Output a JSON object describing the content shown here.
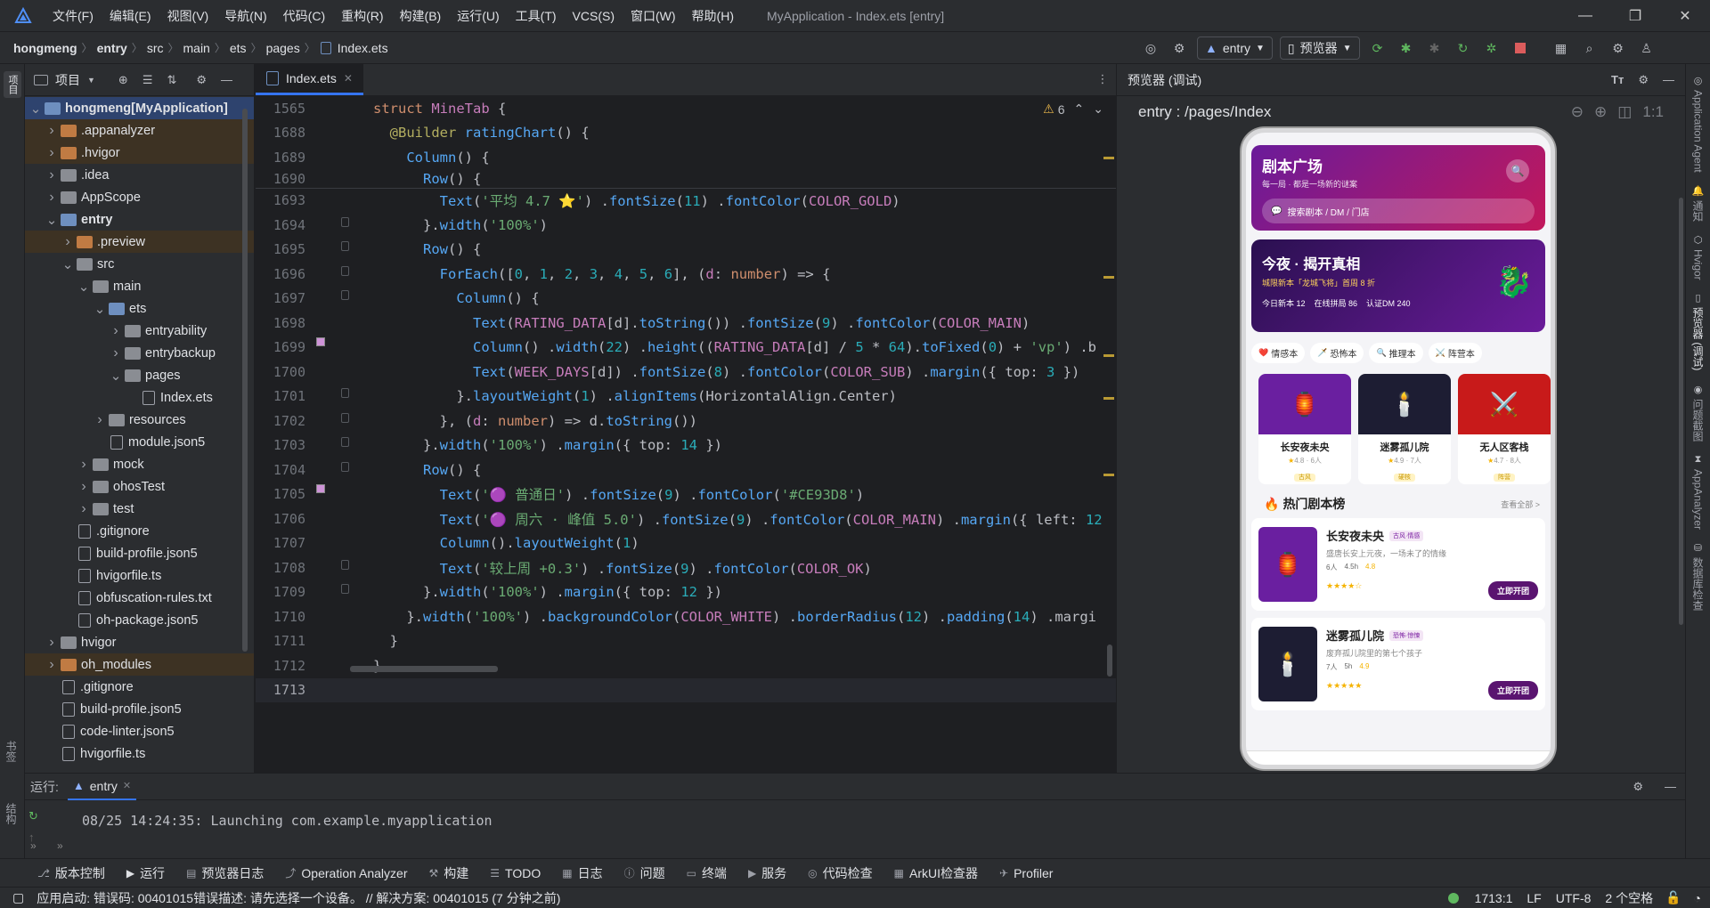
{
  "window": {
    "menus": [
      "文件(F)",
      "编辑(E)",
      "视图(V)",
      "导航(N)",
      "代码(C)",
      "重构(R)",
      "构建(B)",
      "运行(U)",
      "工具(T)",
      "VCS(S)",
      "窗口(W)",
      "帮助(H)"
    ],
    "title": "MyApplication - Index.ets [entry]"
  },
  "nav": {
    "breadcrumbs": [
      "hongmeng",
      "entry",
      "src",
      "main",
      "ets",
      "pages",
      "Index.ets"
    ],
    "run_config": "entry",
    "device": "预览器"
  },
  "project": {
    "title": "项目",
    "tree": [
      {
        "label": "hongmeng",
        "suffix": " [MyApplication]",
        "depth": 0,
        "arrow": "open",
        "kind": "folder-blue",
        "sel": true
      },
      {
        "label": ".appanalyzer",
        "depth": 1,
        "arrow": "closed",
        "kind": "folder-orange",
        "hl": true
      },
      {
        "label": ".hvigor",
        "depth": 1,
        "arrow": "closed",
        "kind": "folder-orange",
        "hl": true
      },
      {
        "label": ".idea",
        "depth": 1,
        "arrow": "closed",
        "kind": "folder-gray"
      },
      {
        "label": "AppScope",
        "depth": 1,
        "arrow": "closed",
        "kind": "folder-gray"
      },
      {
        "label": "entry",
        "depth": 1,
        "arrow": "open",
        "kind": "folder-blue",
        "bold": true
      },
      {
        "label": ".preview",
        "depth": 2,
        "arrow": "closed",
        "kind": "folder-orange",
        "hl": true
      },
      {
        "label": "src",
        "depth": 2,
        "arrow": "open",
        "kind": "folder-gray"
      },
      {
        "label": "main",
        "depth": 3,
        "arrow": "open",
        "kind": "folder-gray"
      },
      {
        "label": "ets",
        "depth": 4,
        "arrow": "open",
        "kind": "folder-blue"
      },
      {
        "label": "entryability",
        "depth": 5,
        "arrow": "closed",
        "kind": "folder-gray"
      },
      {
        "label": "entrybackup",
        "depth": 5,
        "arrow": "closed",
        "kind": "folder-gray"
      },
      {
        "label": "pages",
        "depth": 5,
        "arrow": "open",
        "kind": "folder-gray"
      },
      {
        "label": "Index.ets",
        "depth": 6,
        "arrow": "none",
        "kind": "file"
      },
      {
        "label": "resources",
        "depth": 4,
        "arrow": "closed",
        "kind": "folder-gray"
      },
      {
        "label": "module.json5",
        "depth": 4,
        "arrow": "none",
        "kind": "file"
      },
      {
        "label": "mock",
        "depth": 3,
        "arrow": "closed",
        "kind": "folder-gray"
      },
      {
        "label": "ohosTest",
        "depth": 3,
        "arrow": "closed",
        "kind": "folder-gray"
      },
      {
        "label": "test",
        "depth": 3,
        "arrow": "closed",
        "kind": "folder-gray"
      },
      {
        "label": ".gitignore",
        "depth": 2,
        "arrow": "none",
        "kind": "file"
      },
      {
        "label": "build-profile.json5",
        "depth": 2,
        "arrow": "none",
        "kind": "file"
      },
      {
        "label": "hvigorfile.ts",
        "depth": 2,
        "arrow": "none",
        "kind": "file"
      },
      {
        "label": "obfuscation-rules.txt",
        "depth": 2,
        "arrow": "none",
        "kind": "file"
      },
      {
        "label": "oh-package.json5",
        "depth": 2,
        "arrow": "none",
        "kind": "file"
      },
      {
        "label": "hvigor",
        "depth": 1,
        "arrow": "closed",
        "kind": "folder-gray"
      },
      {
        "label": "oh_modules",
        "depth": 1,
        "arrow": "closed",
        "kind": "folder-orange",
        "hl": true
      },
      {
        "label": ".gitignore",
        "depth": 1,
        "arrow": "none",
        "kind": "file"
      },
      {
        "label": "build-profile.json5",
        "depth": 1,
        "arrow": "none",
        "kind": "file"
      },
      {
        "label": "code-linter.json5",
        "depth": 1,
        "arrow": "none",
        "kind": "file"
      },
      {
        "label": "hvigorfile.ts",
        "depth": 1,
        "arrow": "none",
        "kind": "file"
      }
    ]
  },
  "editor": {
    "tab": "Index.ets",
    "warnings": "6",
    "sticky": [
      {
        "ln": "1565",
        "html": "<span class='kw'>struct</span> <span class='ty'>MineTab</span> {"
      },
      {
        "ln": "1688",
        "html": "  <span class='dec'>@Builder</span> <span class='fn'>ratingChart</span>() {"
      },
      {
        "ln": "1689",
        "html": "    <span class='fn'>Column</span>() {"
      },
      {
        "ln": "1690",
        "html": "      <span class='fn'>Row</span>() {"
      }
    ],
    "lines": [
      {
        "ln": "1693",
        "html": "        <span class='fn'>Text</span>(<span class='str'>'平均 4.7 ⭐'</span>) .<span class='fn'>fontSize</span>(<span class='num'>11</span>) .<span class='fn'>fontColor</span>(<span class='cn'>COLOR_GOLD</span>)"
      },
      {
        "ln": "1694",
        "html": "      }.<span class='fn'>width</span>(<span class='str'>'100%'</span>)"
      },
      {
        "ln": "1695",
        "html": "      <span class='fn'>Row</span>() {"
      },
      {
        "ln": "1696",
        "html": "        <span class='fn'>ForEach</span>([<span class='num'>0</span>, <span class='num'>1</span>, <span class='num'>2</span>, <span class='num'>3</span>, <span class='num'>4</span>, <span class='num'>5</span>, <span class='num'>6</span>], (<span class='param'>d</span>: <span class='kw'>number</span>) => {"
      },
      {
        "ln": "1697",
        "html": "          <span class='fn'>Column</span>() {"
      },
      {
        "ln": "1698",
        "html": "            <span class='fn'>Text</span>(<span class='cn'>RATING_DATA</span>[d].<span class='fn'>toString</span>()) .<span class='fn'>fontSize</span>(<span class='num'>9</span>) .<span class='fn'>fontColor</span>(<span class='cn'>COLOR_MAIN</span>)"
      },
      {
        "ln": "1699",
        "html": "            <span class='fn'>Column</span>() .<span class='fn'>width</span>(<span class='num'>22</span>) .<span class='fn'>height</span>((<span class='cn'>RATING_DATA</span>[d] / <span class='num'>5</span> * <span class='num'>64</span>).<span class='fn'>toFixed</span>(<span class='num'>0</span>) + <span class='str'>'vp'</span>) .b"
      },
      {
        "ln": "1700",
        "html": "            <span class='fn'>Text</span>(<span class='cn'>WEEK_DAYS</span>[d]) .<span class='fn'>fontSize</span>(<span class='num'>8</span>) .<span class='fn'>fontColor</span>(<span class='cn'>COLOR_SUB</span>) .<span class='fn'>margin</span>({ top: <span class='num'>3</span> })"
      },
      {
        "ln": "1701",
        "html": "          }.<span class='fn'>layoutWeight</span>(<span class='num'>1</span>) .<span class='fn'>alignItems</span>(HorizontalAlign.Center)"
      },
      {
        "ln": "1702",
        "html": "        }, (<span class='param'>d</span>: <span class='kw'>number</span>) => d.<span class='fn'>toString</span>())"
      },
      {
        "ln": "1703",
        "html": "      }.<span class='fn'>width</span>(<span class='str'>'100%'</span>) .<span class='fn'>margin</span>({ top: <span class='num'>14</span> })"
      },
      {
        "ln": "1704",
        "html": "      <span class='fn'>Row</span>() {"
      },
      {
        "ln": "1705",
        "html": "        <span class='fn'>Text</span>(<span class='str'>'🟣 普通日'</span>) .<span class='fn'>fontSize</span>(<span class='num'>9</span>) .<span class='fn'>fontColor</span>(<span class='str'>'#CE93D8'</span>)"
      },
      {
        "ln": "1706",
        "html": "        <span class='fn'>Text</span>(<span class='str'>'🟣 周六 · 峰值 5.0'</span>) .<span class='fn'>fontSize</span>(<span class='num'>9</span>) .<span class='fn'>fontColor</span>(<span class='cn'>COLOR_MAIN</span>) .<span class='fn'>margin</span>({ left: <span class='num'>12</span>"
      },
      {
        "ln": "1707",
        "html": "        <span class='fn'>Column</span>().<span class='fn'>layoutWeight</span>(<span class='num'>1</span>)"
      },
      {
        "ln": "1708",
        "html": "        <span class='fn'>Text</span>(<span class='str'>'较上周 +0.3'</span>) .<span class='fn'>fontSize</span>(<span class='num'>9</span>) .<span class='fn'>fontColor</span>(<span class='cn'>COLOR_OK</span>)"
      },
      {
        "ln": "1709",
        "html": "      }.<span class='fn'>width</span>(<span class='str'>'100%'</span>) .<span class='fn'>margin</span>({ top: <span class='num'>12</span> })"
      },
      {
        "ln": "1710",
        "html": "    }.<span class='fn'>width</span>(<span class='str'>'100%'</span>) .<span class='fn'>backgroundColor</span>(<span class='cn'>COLOR_WHITE</span>) .<span class='fn'>borderRadius</span>(<span class='num'>12</span>) .<span class='fn'>padding</span>(<span class='num'>14</span>) .margi"
      },
      {
        "ln": "1711",
        "html": "  }"
      },
      {
        "ln": "1712",
        "html": "}"
      },
      {
        "ln": "1713",
        "html": ""
      }
    ]
  },
  "preview": {
    "title": "预览器 (调试)",
    "path": "entry : /pages/Index",
    "app": {
      "header_title": "剧本广场",
      "header_sub": "每一局 · 都是一场新的谜案",
      "search_placeholder": "搜索剧本 / DM / 门店",
      "banner_title": "今夜 · 揭开真相",
      "banner_sub": "城限新本「龙城飞将」首周 8 折",
      "banner_stats": [
        "今日新本 12",
        "在线拼局 86",
        "认证DM 240"
      ],
      "categories": [
        "情感本",
        "恐怖本",
        "推理本",
        "阵营本"
      ],
      "cards": [
        {
          "name": "长安夜未央",
          "meta": "4.8 · 6人",
          "tag": "古风",
          "bg": "#6a1fa0",
          "icon": "🏮"
        },
        {
          "name": "迷雾孤儿院",
          "meta": "4.9 · 7人",
          "tag": "硬核",
          "bg": "#1d1d33",
          "icon": "🕯️"
        },
        {
          "name": "无人区客栈",
          "meta": "4.7 · 8人",
          "tag": "阵营",
          "bg": "#c81a1a",
          "icon": "⚔️"
        }
      ],
      "hot_title": "热门剧本榜",
      "hot_more": "查看全部 >",
      "hot": [
        {
          "name": "长安夜未央",
          "tags": "古风·情感",
          "desc": "盛唐长安上元夜，一场未了的情缘",
          "people": "6人",
          "time": "4.5h",
          "score": "4.8",
          "stars": "★★★★☆",
          "btn": "立即开团",
          "bg": "#6a1fa0",
          "icon": "🏮"
        },
        {
          "name": "迷雾孤儿院",
          "tags": "恐怖·惊悚",
          "desc": "废弃孤儿院里的第七个孩子",
          "people": "7人",
          "time": "5h",
          "score": "4.9",
          "stars": "★★★★★",
          "btn": "立即开团",
          "bg": "#1d1d33",
          "icon": "🕯️"
        }
      ]
    }
  },
  "right_tools": [
    "Application Agent",
    "通知",
    "Hvigor",
    "预览器 (调试)",
    "问题截图",
    "AppAnalyzer",
    "数据库检查"
  ],
  "left_tools": [
    "项目",
    "书签",
    "结构"
  ],
  "run": {
    "label": "运行:",
    "config": "entry",
    "log": "08/25 14:24:35: Launching com.example.myapplication"
  },
  "bottom_tools": [
    "版本控制",
    "运行",
    "预览器日志",
    "Operation Analyzer",
    "构建",
    "TODO",
    "日志",
    "问题",
    "终端",
    "服务",
    "代码检查",
    "ArkUI检查器",
    "Profiler"
  ],
  "status": {
    "message": "应用启动: 错误码: 00401015错误描述: 请先选择一个设备。 // 解决方案: 00401015 (7 分钟之前)",
    "position": "1713:1",
    "line_sep": "LF",
    "encoding": "UTF-8",
    "indent": "2 个空格"
  },
  "colors": {
    "accent": "#3574f0",
    "app_primary": "#7b1fa2",
    "app_dark": "#3b0f57"
  }
}
